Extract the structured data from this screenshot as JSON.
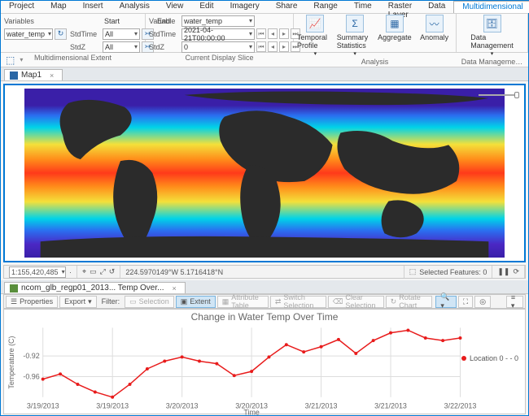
{
  "menu": {
    "items": [
      "Project",
      "Map",
      "Insert",
      "Analysis",
      "View",
      "Edit",
      "Imagery",
      "Share",
      "Range",
      "Time",
      "Raster Layer",
      "Data",
      "Multidimensional"
    ],
    "active": 12
  },
  "ribbon": {
    "variables": {
      "label": "Variables",
      "value": "water_temp"
    },
    "start": {
      "label": "Start",
      "stdtime": "All",
      "stdz": "All"
    },
    "end": {
      "label": "End"
    },
    "group1_label": "Multidimensional Extent",
    "slice": {
      "variable_label": "Variable",
      "variable": "water_temp",
      "stdtime": "2021-04-21T00:00:00",
      "stdz": "0"
    },
    "group2_label": "Current Display Slice",
    "analysis": {
      "label": "Analysis",
      "temporal": "Temporal Profile",
      "summary": "Summary Statistics",
      "aggregate": "Aggregate",
      "anomaly": "Anomaly"
    },
    "datamgmt": {
      "label": "Data Manageme…",
      "btn": "Data Management"
    }
  },
  "map_tab": "Map1",
  "status": {
    "scale": "1:155,420,485",
    "coords": "224.5970149°W 5.1716418°N",
    "sel": "Selected Features: 0"
  },
  "chart_tab": "ncom_glb_regp01_2013... Temp Over...",
  "ct": {
    "properties": "Properties",
    "export": "Export",
    "filter": "Filter:",
    "selection": "Selection",
    "extent": "Extent",
    "attrtable": "Attribute Table",
    "switchsel": "Switch Selection",
    "clearsel": "Clear Selection",
    "rotate": "Rotate Chart"
  },
  "chart_data": {
    "type": "line",
    "title": "Change in Water Temp Over Time",
    "xlabel": "Time",
    "ylabel": "Temperature (C)",
    "x_ticks": [
      "3/19/2013",
      "3/19/2013",
      "3/20/2013",
      "3/20/2013",
      "3/21/2013",
      "3/21/2013",
      "3/22/2013"
    ],
    "y_ticks": [
      -0.92,
      -0.96
    ],
    "series": [
      {
        "name": "Location 0 - - 0",
        "values": [
          -0.965,
          -0.955,
          -0.975,
          -0.99,
          -1.0,
          -0.975,
          -0.945,
          -0.93,
          -0.922,
          -0.93,
          -0.935,
          -0.958,
          -0.95,
          -0.922,
          -0.898,
          -0.912,
          -0.902,
          -0.888,
          -0.915,
          -0.89,
          -0.875,
          -0.87,
          -0.885,
          -0.89,
          -0.885
        ]
      }
    ],
    "ylim": [
      -1.0,
      -0.865
    ]
  }
}
